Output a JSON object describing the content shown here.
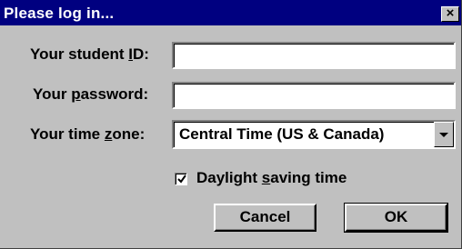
{
  "window": {
    "title": "Please log in...",
    "close_glyph": "×"
  },
  "form": {
    "student_id": {
      "label_pre": "Your student ",
      "label_accel": "I",
      "label_post": "D:",
      "value": ""
    },
    "password": {
      "label_pre": "Your ",
      "label_accel": "p",
      "label_post": "assword:",
      "value": ""
    },
    "time_zone": {
      "label_pre": "Your time ",
      "label_accel": "z",
      "label_post": "one:",
      "selected": "Central Time (US & Canada)"
    },
    "dst": {
      "label_pre": "Daylight ",
      "label_accel": "s",
      "label_post": "aving time",
      "checked": true
    }
  },
  "buttons": {
    "cancel": "Cancel",
    "ok": "OK"
  },
  "colors": {
    "titlebar": "#000080",
    "face": "#c0c0c0"
  }
}
